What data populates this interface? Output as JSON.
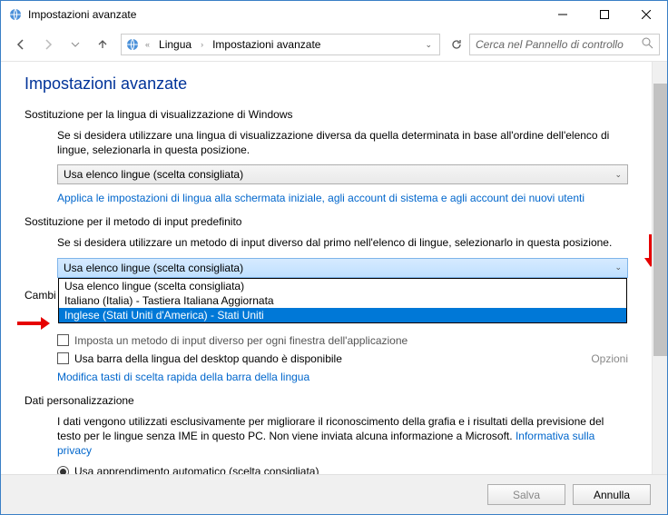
{
  "window": {
    "title": "Impostazioni avanzate"
  },
  "nav": {
    "crumb1": "Lingua",
    "crumb2": "Impostazioni avanzate",
    "search_placeholder": "Cerca nel Pannello di controllo"
  },
  "page": {
    "title": "Impostazioni avanzate",
    "section1": {
      "header": "Sostituzione per la lingua di visualizzazione di Windows",
      "body": "Se si desidera utilizzare una lingua di visualizzazione diversa da quella determinata in base all'ordine dell'elenco di lingue, selezionarla in questa posizione.",
      "combo": "Usa elenco lingue (scelta consigliata)",
      "link": "Applica le impostazioni di lingua alla schermata iniziale, agli account di sistema e agli account dei nuovi utenti"
    },
    "section2": {
      "header": "Sostituzione per il metodo di input predefinito",
      "body": "Se si desidera utilizzare un metodo di input diverso dal primo nell'elenco di lingue, selezionarlo in questa posizione.",
      "combo": "Usa elenco lingue (scelta consigliata)",
      "opt0": "Usa elenco lingue (scelta consigliata)",
      "opt1": "Italiano (Italia) - Tastiera Italiana Aggiornata",
      "opt2": "Inglese (Stati Uniti d'America) - Stati Uniti"
    },
    "section3": {
      "header_partial": "Cambi",
      "cb1": "Imposta un metodo di input diverso per ogni finestra dell'applicazione",
      "cb2": "Usa barra della lingua del desktop quando è disponibile",
      "opzioni": "Opzioni",
      "link": "Modifica tasti di scelta rapida della barra della lingua"
    },
    "section4": {
      "header": "Dati personalizzazione",
      "body": "I dati vengono utilizzati esclusivamente per migliorare il riconoscimento della grafia e i risultati della previsione del testo per le lingue senza IME in questo PC. Non viene inviata alcuna informazione a Microsoft. ",
      "privacy_link": "Informativa sulla privacy",
      "radio1": "Usa apprendimento automatico (scelta consigliata)"
    }
  },
  "footer": {
    "save": "Salva",
    "cancel": "Annulla"
  }
}
